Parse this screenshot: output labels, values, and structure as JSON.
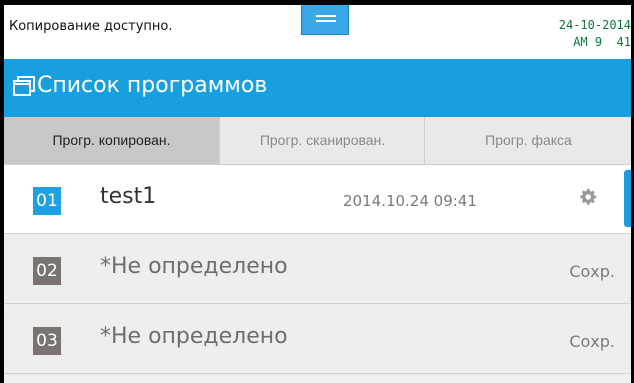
{
  "status": {
    "message": "Копирование доступно.",
    "date": "24-10-2014",
    "time": "AM 9  41"
  },
  "header": {
    "title": "Список программов",
    "icon": "window-icon",
    "accent": "#189fe0"
  },
  "tabs": [
    {
      "label": "Прогр. копирован.",
      "active": true
    },
    {
      "label": "Прогр. сканирован.",
      "active": false
    },
    {
      "label": "Прогр. факса",
      "active": false
    }
  ],
  "programs": [
    {
      "number": "01",
      "name": "test1",
      "date": "2014.10.24 09:41",
      "action": "gear-icon"
    },
    {
      "number": "02",
      "name": "*Не определено",
      "action_label": "Сохр."
    },
    {
      "number": "03",
      "name": "*Не определено",
      "action_label": "Сохр."
    }
  ]
}
